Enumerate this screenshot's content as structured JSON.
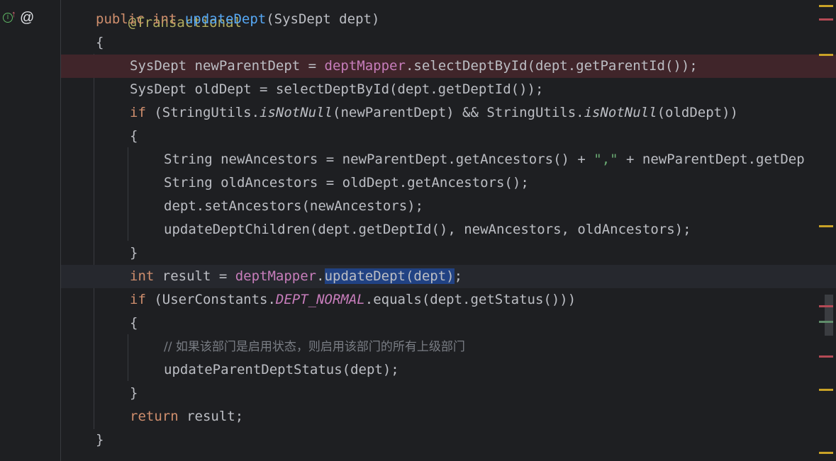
{
  "gutter": {
    "implements_icon": "implements-icon",
    "override_arrow_icon": "up-arrow-icon",
    "annotation_icon": "at-icon"
  },
  "editor": {
    "lines": [
      {
        "t": "@Transactional"
      },
      {
        "t": "public int updateDept(SysDept dept)"
      },
      {
        "t": "{"
      },
      {
        "t": "SysDept newParentDept = deptMapper.selectDeptById(dept.getParentId());"
      },
      {
        "t": "SysDept oldDept = selectDeptById(dept.getDeptId());"
      },
      {
        "t": "if (StringUtils.isNotNull(newParentDept) && StringUtils.isNotNull(oldDept))"
      },
      {
        "t": "{"
      },
      {
        "t": "String newAncestors = newParentDept.getAncestors() + \",\" + newParentDept.getDep"
      },
      {
        "t": "String oldAncestors = oldDept.getAncestors();"
      },
      {
        "t": "dept.setAncestors(newAncestors);"
      },
      {
        "t": "updateDeptChildren(dept.getDeptId(), newAncestors, oldAncestors);"
      },
      {
        "t": "}"
      },
      {
        "t": "int result = deptMapper.updateDept(dept);"
      },
      {
        "t": "if (UserConstants.DEPT_NORMAL.equals(dept.getStatus()))"
      },
      {
        "t": "{"
      },
      {
        "t": "// 如果该部门是启用状态，则启用该部门的所有上级部门"
      },
      {
        "t": "updateParentDeptStatus(dept);"
      },
      {
        "t": "}"
      },
      {
        "t": "return result;"
      },
      {
        "t": "}"
      }
    ]
  },
  "colors": {
    "background": "#1e1f22",
    "keyword": "#cf8e6d",
    "method_decl": "#56a8f5",
    "field": "#c77dbb",
    "string": "#6aab73",
    "comment": "#7a7e85",
    "breakpoint_line": "#40252a",
    "selection": "#214283"
  }
}
